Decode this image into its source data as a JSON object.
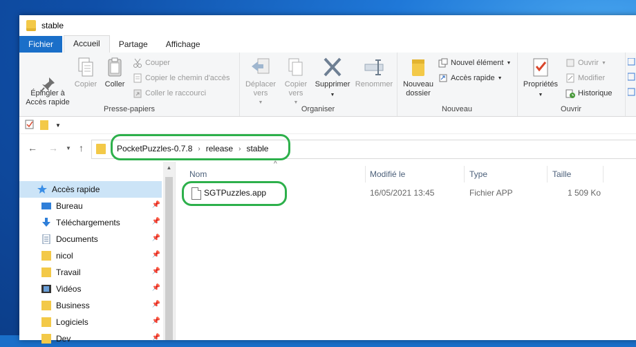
{
  "window": {
    "title": "stable"
  },
  "tabs": [
    "Fichier",
    "Accueil",
    "Partage",
    "Affichage"
  ],
  "ribbon": {
    "pin": "Épingler à\nAccès rapide",
    "copy": "Copier",
    "paste": "Coller",
    "cut": "Couper",
    "copy_path": "Copier le chemin d'accès",
    "paste_shortcut": "Coller le raccourci",
    "group_clipboard": "Presse-papiers",
    "move_to": "Déplacer\nvers",
    "copy_to": "Copier\nvers",
    "delete": "Supprimer",
    "rename": "Renommer",
    "group_organize": "Organiser",
    "new_folder": "Nouveau\ndossier",
    "new_item": "Nouvel élément",
    "quick_access": "Accès rapide",
    "group_new": "Nouveau",
    "properties": "Propriétés",
    "open": "Ouvrir",
    "modify": "Modifier",
    "history": "Historique",
    "group_open": "Ouvrir"
  },
  "address": {
    "crumbs": [
      "PocketPuzzles-0.7.8",
      "release",
      "stable"
    ]
  },
  "sidebar": {
    "items": [
      {
        "label": "Accès rapide",
        "icon": "star-icon"
      },
      {
        "label": "Bureau",
        "icon": "desktop-icon"
      },
      {
        "label": "Téléchargements",
        "icon": "download-icon"
      },
      {
        "label": "Documents",
        "icon": "documents-icon"
      },
      {
        "label": "nicol",
        "icon": "folder-icon"
      },
      {
        "label": "Travail",
        "icon": "folder-icon"
      },
      {
        "label": "Vidéos",
        "icon": "videos-icon"
      },
      {
        "label": "Business",
        "icon": "folder-icon"
      },
      {
        "label": "Logiciels",
        "icon": "folder-icon"
      },
      {
        "label": "Dev",
        "icon": "folder-icon"
      }
    ]
  },
  "columns": {
    "name": "Nom",
    "modified": "Modifié le",
    "type": "Type",
    "size": "Taille"
  },
  "files": [
    {
      "name": "SGTPuzzles.app",
      "modified": "16/05/2021 13:45",
      "type": "Fichier APP",
      "size": "1 509 Ko"
    }
  ],
  "colors": {
    "accent": "#1a6fc9",
    "highlight": "#2db04b",
    "selected": "#cce4f7",
    "folder": "#f3c948"
  }
}
